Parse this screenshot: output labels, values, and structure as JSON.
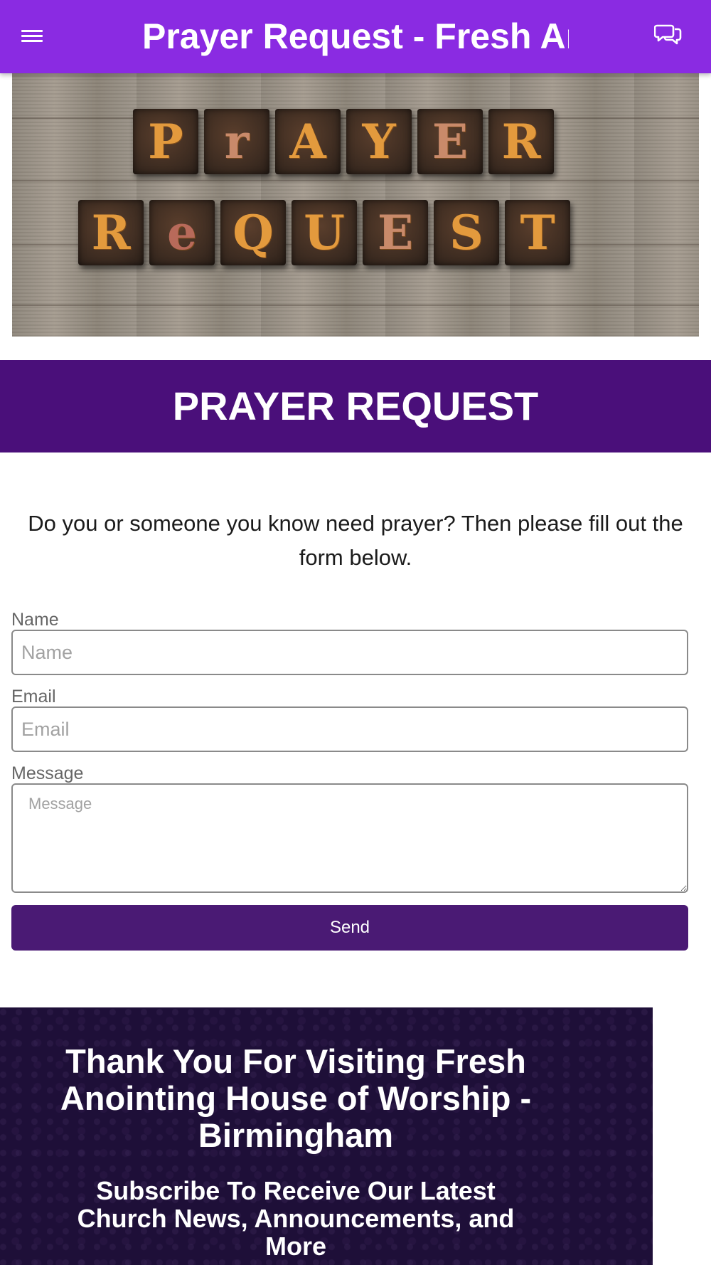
{
  "app_bar": {
    "title": "Prayer Request - Fresh Anointing House of Worship - Birmingham",
    "bg_color": "#8a2be2",
    "menu_icon": "hamburger-menu-icon",
    "chat_icon": "chat-bubbles-icon"
  },
  "hero_image": {
    "line1": [
      "P",
      "r",
      "A",
      "Y",
      "E",
      "R"
    ],
    "line2": [
      "R",
      "e",
      "Q",
      "U",
      "E",
      "S",
      "T"
    ]
  },
  "banner": {
    "title": "PRAYER REQUEST",
    "bg_color": "#4a0f7a"
  },
  "intro_text": "Do you or someone you know need prayer? Then please fill out the form below.",
  "form": {
    "name_label": "Name",
    "name_placeholder": "Name",
    "email_label": "Email",
    "email_placeholder": "Email",
    "message_label": "Message",
    "message_placeholder": "Message",
    "send_label": "Send",
    "button_color": "#4a1a74"
  },
  "footer": {
    "title": "Thank You For Visiting Fresh Anointing House of Worship - Birmingham",
    "subtitle": "Subscribe To Receive Our Latest Church News, Announcements, and More",
    "bg_color": "#1e0f38"
  }
}
